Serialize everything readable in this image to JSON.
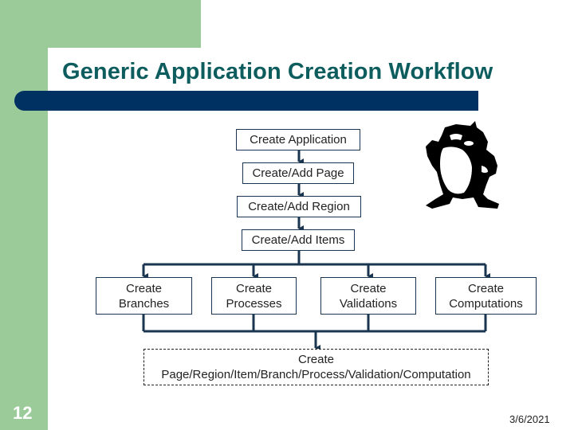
{
  "slide": {
    "title": "Generic Application Creation Workflow",
    "slide_number": "12",
    "date": "3/6/2021",
    "colors": {
      "green": "#9ccb9a",
      "title_teal": "#0e5d5e",
      "navy_bar": "#003163",
      "connector": "#1a3550"
    }
  },
  "workflow": {
    "steps": [
      {
        "label": "Create Application"
      },
      {
        "label": "Create/Add Page"
      },
      {
        "label": "Create/Add Region"
      },
      {
        "label": "Create/Add Items"
      }
    ],
    "branches": [
      {
        "line1": "Create",
        "line2": "Branches"
      },
      {
        "line1": "Create",
        "line2": "Processes"
      },
      {
        "line1": "Create",
        "line2": "Validations"
      },
      {
        "line1": "Create",
        "line2": "Computations"
      }
    ],
    "final": {
      "line1": "Create",
      "line2": "Page/Region/Item/Branch/Process/Validation/Computation"
    }
  },
  "illustration": {
    "icon": "tasmanian-devil-cartoon"
  }
}
